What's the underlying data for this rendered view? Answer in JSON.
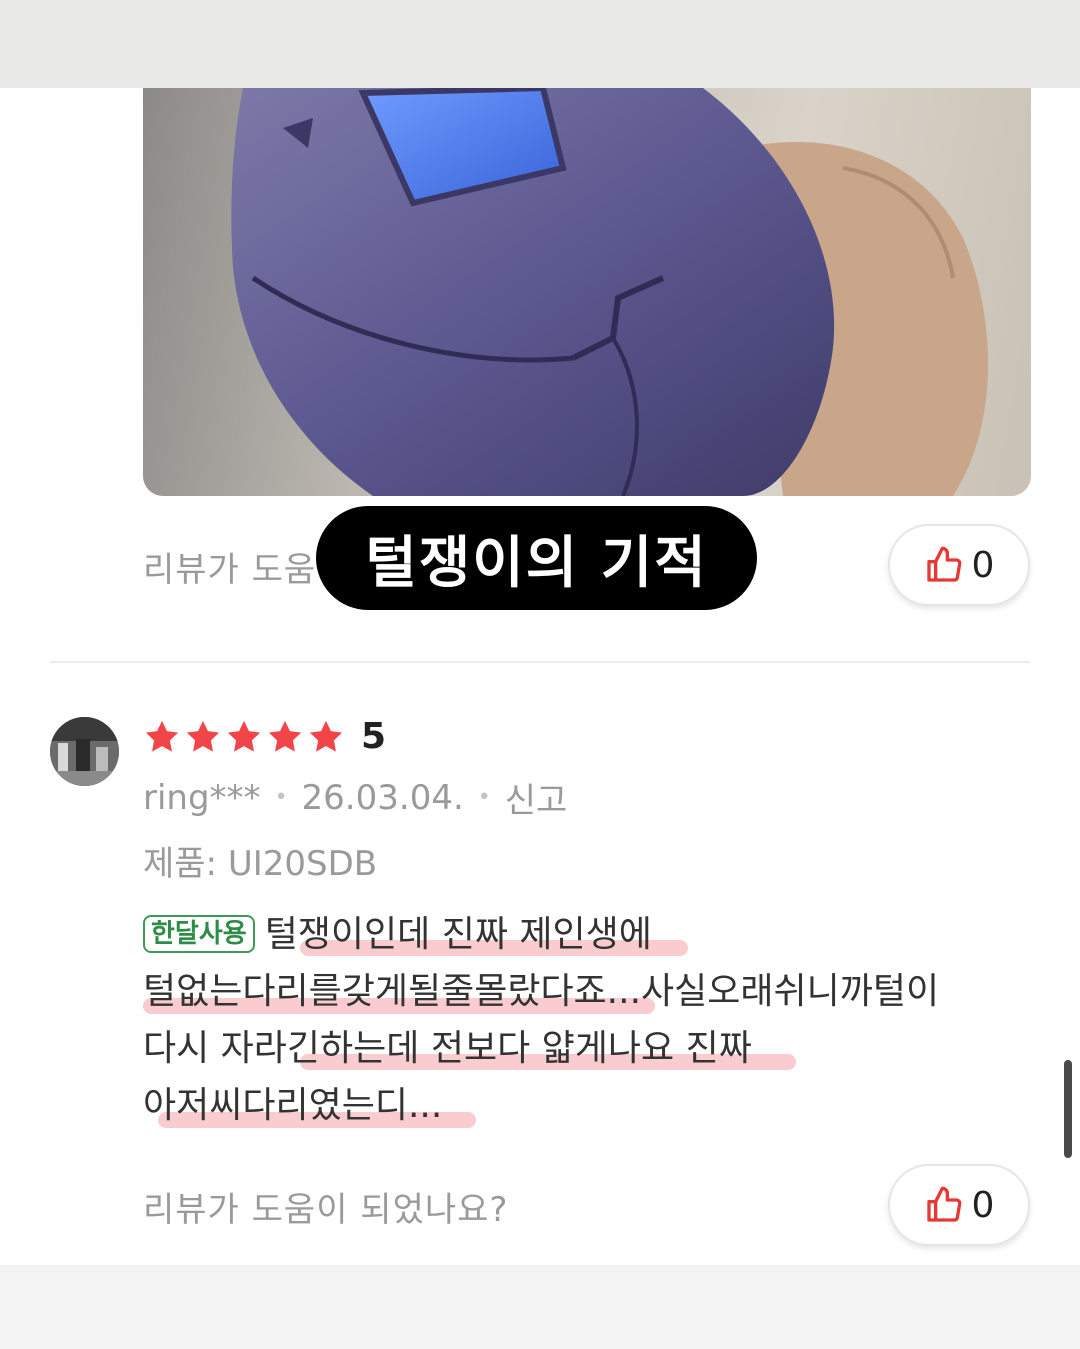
{
  "review_top": {
    "helpful_prompt": "리뷰가 도움",
    "like_count": "0"
  },
  "caption": "털쟁이의 기적",
  "review": {
    "rating_text": "5",
    "rating": 5,
    "author": "ring***",
    "date": "26.03.04.",
    "report_label": "신고",
    "product": "제품: UI20SDB",
    "badge": "한달사용",
    "lines": [
      "털쟁이인데 진짜 제인생에",
      "털없는다리를갖게될줄몰랐다죠...사실오래쉬니까털이",
      "다시 자라긴하는데 전보다 얇게나요 진짜",
      "아저씨다리였는디..."
    ],
    "helpful_prompt": "리뷰가 도움이 되었나요?",
    "like_count": "0"
  },
  "colors": {
    "star": "#f2454a",
    "like_icon": "#e53935",
    "badge": "#2e8c49",
    "highlight": "#f47882"
  },
  "icons": [
    "thumbs-up-icon",
    "star-icon"
  ]
}
